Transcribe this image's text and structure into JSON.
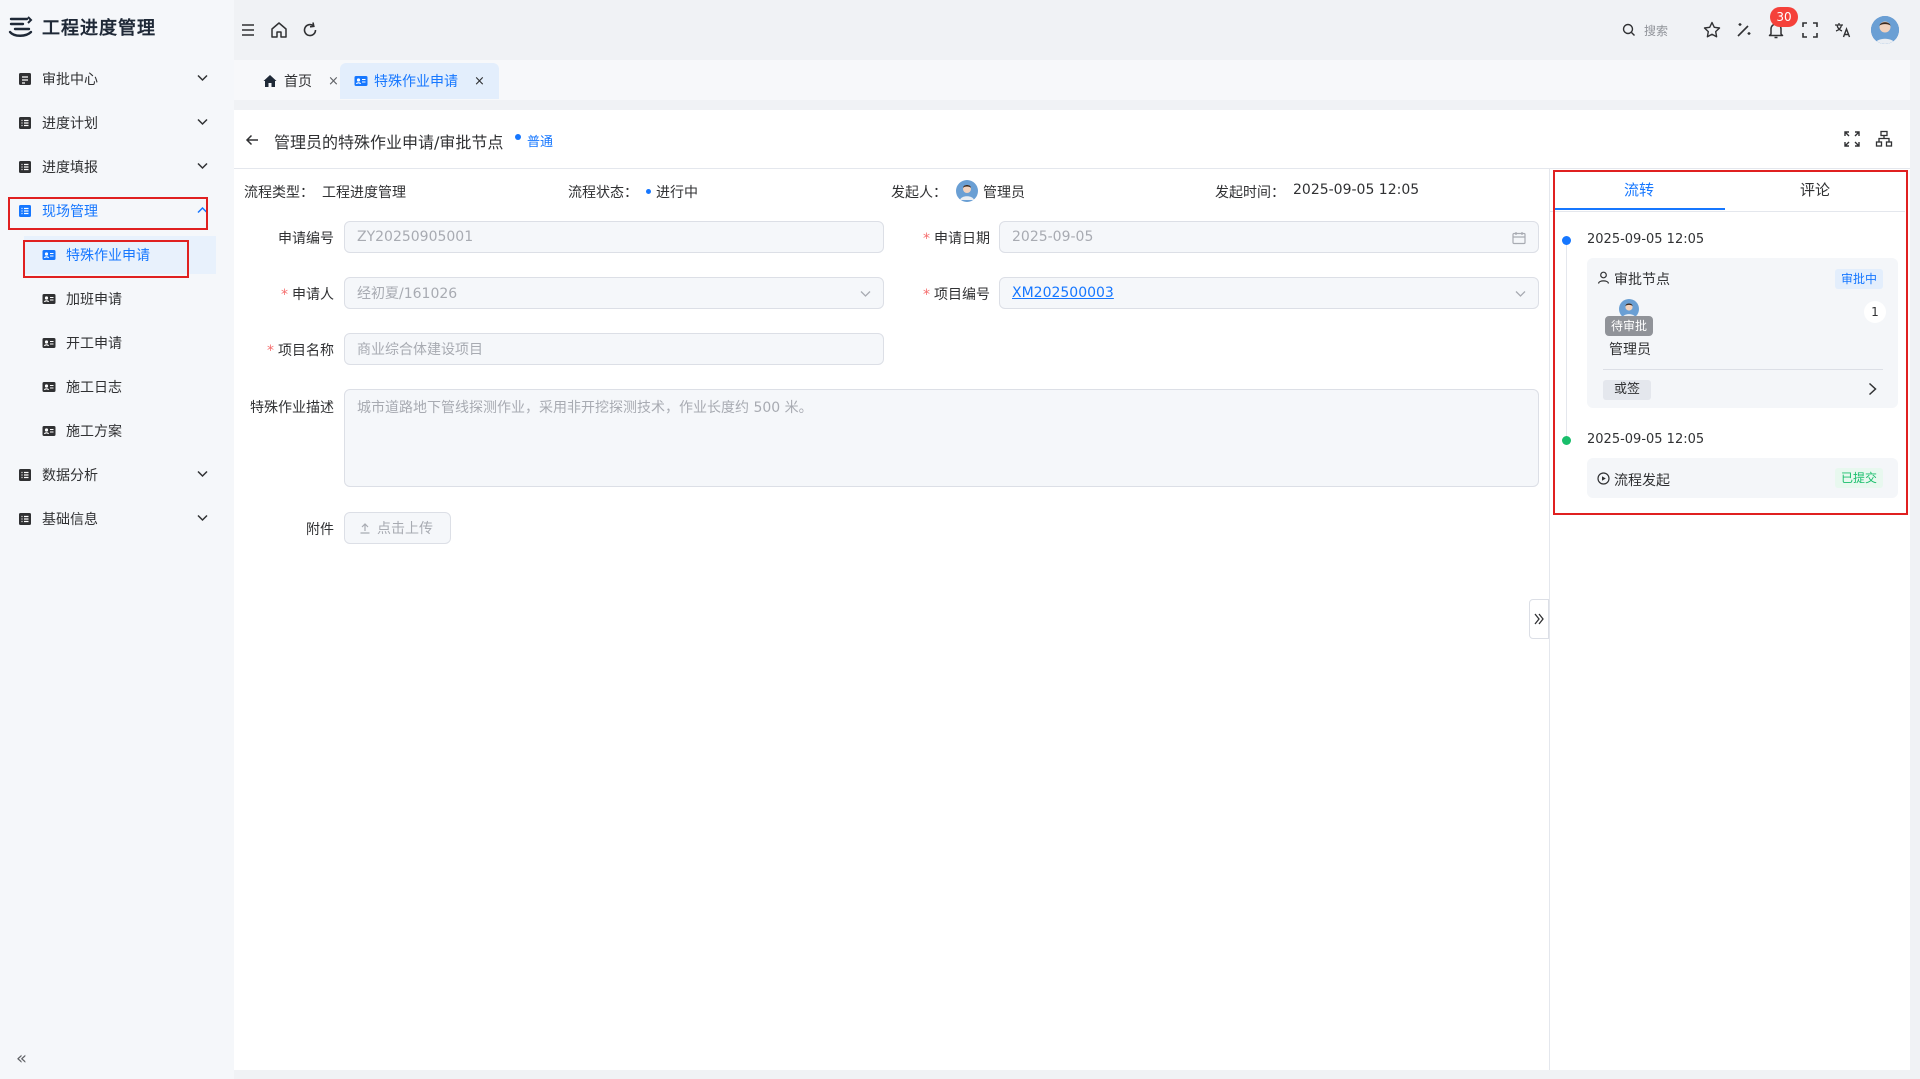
{
  "app": {
    "title": "工程进度管理"
  },
  "sidebar": {
    "items": [
      {
        "label": "审批中心"
      },
      {
        "label": "进度计划"
      },
      {
        "label": "进度填报"
      },
      {
        "label": "现场管理"
      },
      {
        "label": "数据分析"
      },
      {
        "label": "基础信息"
      }
    ],
    "sub_items": [
      {
        "label": "特殊作业申请"
      },
      {
        "label": "加班申请"
      },
      {
        "label": "开工申请"
      },
      {
        "label": "施工日志"
      },
      {
        "label": "施工方案"
      }
    ],
    "collapse_glyph": "«"
  },
  "topbar": {
    "search_placeholder": "搜索",
    "notification_count": "30"
  },
  "tabs": [
    {
      "label": "首页",
      "close": "×"
    },
    {
      "label": "特殊作业申请",
      "close": "×"
    }
  ],
  "header": {
    "title": "管理员的特殊作业申请/审批节点",
    "tag": "普通"
  },
  "info": {
    "flow_type_label": "流程类型：",
    "flow_type_value": "工程进度管理",
    "status_label": "流程状态：",
    "status_value": "进行中",
    "initiator_label": "发起人：",
    "initiator_value": "管理员",
    "time_label": "发起时间：",
    "time_value": "2025-09-05 12:05"
  },
  "form": {
    "app_no_label": "申请编号",
    "app_no_value": "ZY20250905001",
    "app_date_label": "申请日期",
    "app_date_value": "2025-09-05",
    "applicant_label": "申请人",
    "applicant_value": "经初夏/161026",
    "project_no_label": "项目编号",
    "project_no_value": "XM202500003",
    "project_name_label": "项目名称",
    "project_name_value": "商业综合体建设项目",
    "desc_label": "特殊作业描述",
    "desc_value": "城市道路地下管线探测作业，采用非开挖探测技术，作业长度约 500 米。",
    "attach_label": "附件",
    "upload_label": "点击上传",
    "required_mark": "*"
  },
  "right_panel": {
    "tabs": [
      "流转",
      "评论"
    ],
    "timeline": [
      {
        "time": "2025-09-05 12:05",
        "node": "审批节点",
        "status": "审批中",
        "pending": "待审批",
        "approver": "管理员",
        "count": "1",
        "sign_type": "或签"
      },
      {
        "time": "2025-09-05 12:05",
        "node": "流程发起",
        "status": "已提交"
      }
    ]
  },
  "colors": {
    "accent": "#1677ff",
    "success": "#19be6b",
    "danger": "#f5413a",
    "highlight": "#e02020"
  }
}
